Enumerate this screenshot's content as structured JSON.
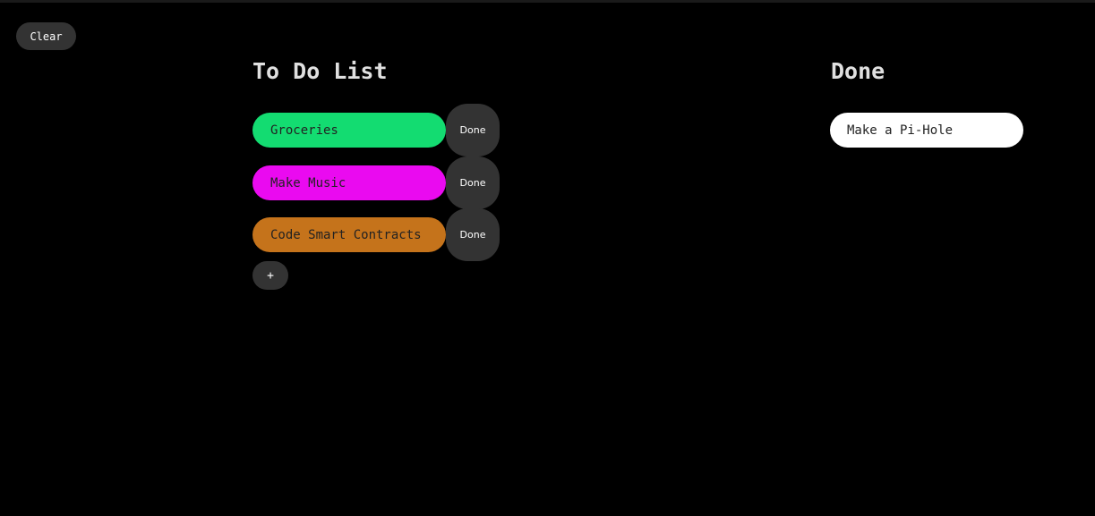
{
  "toolbar": {
    "clear_label": "Clear"
  },
  "todo": {
    "title": "To Do List",
    "items": [
      {
        "label": "Groceries",
        "color": "#13dc71",
        "done_label": "Done"
      },
      {
        "label": "Make Music",
        "color": "#ea0af0",
        "done_label": "Done"
      },
      {
        "label": "Code Smart Contracts",
        "color": "#c5731b",
        "done_label": "Done"
      }
    ],
    "add_label": "+"
  },
  "done": {
    "title": "Done",
    "items": [
      {
        "label": "Make a Pi-Hole",
        "color": "#ffffff"
      }
    ]
  },
  "colors": {
    "background": "#000000",
    "button": "#333333",
    "title_text": "#e0e0e0"
  }
}
